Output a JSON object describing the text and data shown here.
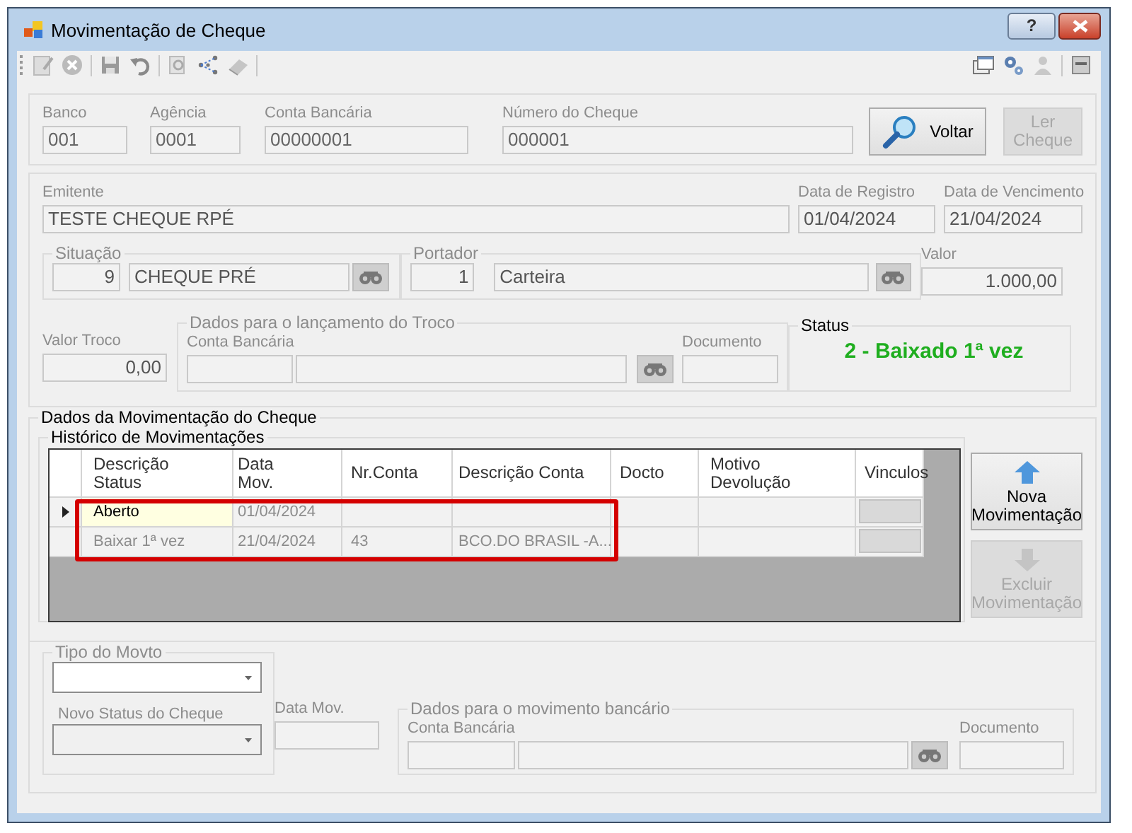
{
  "window": {
    "title": "Movimentação de Cheque",
    "help": "?"
  },
  "cheque_header": {
    "fields": [
      {
        "label": "Banco",
        "value": "001"
      },
      {
        "label": "Agência",
        "value": "0001"
      },
      {
        "label": "Conta Bancária",
        "value": "00000001"
      },
      {
        "label": "Número do Cheque",
        "value": "000001"
      }
    ],
    "buttons": [
      {
        "label": "Voltar",
        "disabled": false,
        "kind": "search"
      },
      {
        "label": "Ler\nCheque",
        "disabled": true,
        "kind": "plain"
      }
    ]
  },
  "details": {
    "emitente": {
      "label": "Emitente",
      "value": "TESTE CHEQUE RPÉ"
    },
    "data_registro": {
      "label": "Data de Registro",
      "value": "01/04/2024"
    },
    "data_vencimento": {
      "label": "Data de Vencimento",
      "value": "21/04/2024"
    },
    "situacao": {
      "title": "Situação",
      "code": "9",
      "description": "CHEQUE PRÉ"
    },
    "portador": {
      "title": "Portador",
      "code": "1",
      "description": "Carteira"
    },
    "valor": {
      "label": "Valor",
      "value": "1.000,00"
    },
    "valor_troco": {
      "label": "Valor Troco",
      "value": "0,00"
    },
    "troco": {
      "title": "Dados para o lançamento do Troco",
      "conta_label": "Conta Bancária",
      "documento_label": "Documento"
    },
    "status": {
      "title": "Status",
      "value": "2 - Baixado 1ª vez"
    }
  },
  "movimentacao": {
    "title": "Dados da Movimentação do Cheque",
    "historico": {
      "title": "Histórico de Movimentações",
      "columns": [
        {
          "label": "Descrição\nStatus",
          "kind": "text"
        },
        {
          "label": "Data\nMov.",
          "kind": "text"
        },
        {
          "label": "Nr.Conta",
          "kind": "text"
        },
        {
          "label": "Descrição Conta",
          "kind": "text"
        },
        {
          "label": "Docto",
          "kind": "text"
        },
        {
          "label": "Motivo\nDevolução",
          "kind": "text"
        },
        {
          "label": "Vinculos",
          "kind": "button"
        }
      ],
      "rows": [
        {
          "current": true,
          "highlighted": true,
          "cells": [
            "Aberto",
            "01/04/2024",
            null,
            null,
            null,
            null,
            null
          ]
        },
        {
          "current": false,
          "highlighted": true,
          "cells": [
            "Baixar 1ª vez",
            "21/04/2024",
            "43",
            "BCO.DO BRASIL -A...",
            null,
            null,
            null
          ]
        }
      ]
    },
    "buttons": [
      {
        "label": "Nova\nMovimentação",
        "disabled": false,
        "kind": "up"
      },
      {
        "label": "Excluir\nMovimentação",
        "disabled": true,
        "kind": "down"
      }
    ]
  },
  "novo_movimento": {
    "tipo_movto": {
      "title": "Tipo do Movto",
      "disabled": false
    },
    "novo_status": {
      "label": "Novo Status do Cheque",
      "disabled": true
    },
    "data_mov": {
      "label": "Data Mov."
    },
    "movimento_bancario": {
      "title": "Dados para o movimento bancário",
      "conta_label": "Conta Bancária",
      "documento_label": "Documento"
    }
  }
}
